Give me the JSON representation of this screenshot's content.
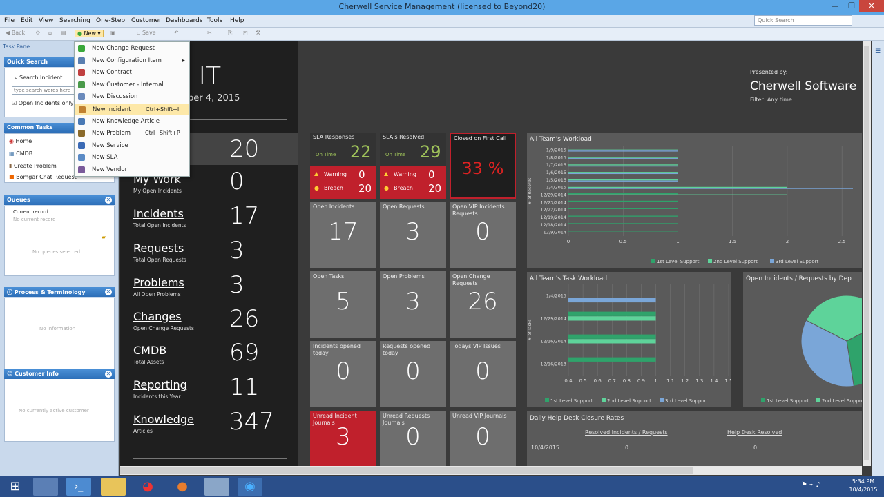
{
  "window": {
    "title": "Cherwell Service Management (licensed to Beyond20)"
  },
  "menubar": [
    "File",
    "Edit",
    "View",
    "Searching",
    "One-Step",
    "Customer",
    "Dashboards",
    "Tools",
    "Help"
  ],
  "quick_search_placeholder": "Quick Search",
  "toolbar": {
    "back": "Back",
    "new": "New",
    "save": "Save"
  },
  "task_pane": {
    "title": "Task Pane",
    "quick_search": {
      "title": "Quick Search",
      "search_label": "Search Incident",
      "input_value": "type search words here",
      "checkbox_label": "Open Incidents only"
    },
    "common_tasks": {
      "title": "Common Tasks",
      "items": [
        "Home",
        "CMDB",
        "Create Problem",
        "Bomgar Chat Request"
      ]
    },
    "queues": {
      "title": "Queues",
      "current_record_label": "Current record",
      "current_record_value": "No current record",
      "empty": "No queues selected"
    },
    "process": {
      "title": "Process & Terminology",
      "empty": "No information"
    },
    "customer": {
      "title": "Customer Info",
      "empty": "No currently active customer"
    }
  },
  "new_menu": [
    {
      "label": "New Change Request",
      "shortcut": "",
      "icon_color": "#3aa83a"
    },
    {
      "label": "New Configuration Item",
      "shortcut": "",
      "icon_color": "#5a7fb0",
      "submenu": true
    },
    {
      "label": "New Contract",
      "shortcut": "",
      "icon_color": "#c04040"
    },
    {
      "label": "New Customer - Internal",
      "shortcut": "",
      "icon_color": "#4a9a4a"
    },
    {
      "label": "New Discussion",
      "shortcut": "",
      "icon_color": "#6a8abb"
    },
    {
      "label": "New Incident",
      "shortcut": "Ctrl+Shift+I",
      "icon_color": "#c08030",
      "highlight": true
    },
    {
      "label": "New Knowledge Article",
      "shortcut": "",
      "icon_color": "#4a7ab5"
    },
    {
      "label": "New Problem",
      "shortcut": "Ctrl+Shift+P",
      "icon_color": "#8a6a2a"
    },
    {
      "label": "New Service",
      "shortcut": "",
      "icon_color": "#3a6ab5"
    },
    {
      "label": "New SLA",
      "shortcut": "",
      "icon_color": "#5a8ac5"
    },
    {
      "label": "New Vendor",
      "shortcut": "",
      "icon_color": "#7a5a9a"
    }
  ],
  "dashboard": {
    "title_partial": "al IT",
    "date_partial": "ber 4, 2015",
    "presented_by": "Presented by:",
    "brand": "Cherwell Software",
    "filter": "Filter: Any time",
    "first_num": "20",
    "first_sub": "nts",
    "metrics": [
      {
        "label": "My Work",
        "sub": "My Open Incidents",
        "value": "0"
      },
      {
        "label": "Incidents",
        "sub": "Total Open Incidents",
        "value": "17"
      },
      {
        "label": "Requests",
        "sub": "Total Open Requests",
        "value": "3"
      },
      {
        "label": "Problems",
        "sub": "All Open Problems",
        "value": "3"
      },
      {
        "label": "Changes",
        "sub": "Open Change Requests",
        "value": "26"
      },
      {
        "label": "CMDB",
        "sub": "Total Assets",
        "value": "69"
      },
      {
        "label": "Reporting",
        "sub": "Incidents this Year",
        "value": "11"
      },
      {
        "label": "Knowledge",
        "sub": "Articles",
        "value": "347"
      }
    ],
    "sla": [
      {
        "title": "SLA Responses",
        "ontime_label": "On Time",
        "ontime": "22",
        "warning_label": "Warning",
        "warning": "0",
        "breach_label": "Breach",
        "breach": "20"
      },
      {
        "title": "SLA's Resolved",
        "ontime_label": "On Time",
        "ontime": "29",
        "warning_label": "Warning",
        "warning": "0",
        "breach_label": "Breach",
        "breach": "20"
      }
    ],
    "first_call": {
      "title": "Closed on First Call",
      "value": "33 %"
    },
    "tiles": [
      {
        "title": "Open Incidents",
        "value": "17"
      },
      {
        "title": "Open Requests",
        "value": "3"
      },
      {
        "title": "Open VIP Incidents Requests",
        "value": "0"
      },
      {
        "title": "Open Tasks",
        "value": "5"
      },
      {
        "title": "Open Problems",
        "value": "3"
      },
      {
        "title": "Open Change Requests",
        "value": "26"
      },
      {
        "title": "Incidents opened today",
        "value": "0"
      },
      {
        "title": "Requests opened today",
        "value": "0"
      },
      {
        "title": "Todays VIP Issues",
        "value": "0"
      },
      {
        "title": "Unread Incident Journals",
        "value": "3",
        "red": true
      },
      {
        "title": "Unread Requests Journals",
        "value": "0"
      },
      {
        "title": "Unread VIP Journals",
        "value": "0"
      }
    ],
    "workload_title": "All Team's Workload",
    "task_workload_title": "All Team's Task Workload",
    "pie_title": "Open Incidents / Requests by Dep",
    "closure": {
      "title": "Daily Help Desk Closure Rates",
      "col1": "Resolved Incidents / Requests",
      "col2": "Help Desk Resolved",
      "row_date": "10/4/2015",
      "row_v1": "0",
      "row_v2": "0"
    }
  },
  "legend": [
    "1st Level Support",
    "2nd Level Support",
    "3rd Level Support"
  ],
  "legend_colors": [
    "#2fa36b",
    "#5ed39a",
    "#7aa6d8"
  ],
  "chart_data": [
    {
      "type": "bar",
      "title": "All Team's Workload",
      "ylabel": "# of Records",
      "categories": [
        "1/9/2015",
        "1/8/2015",
        "1/7/2015",
        "1/6/2015",
        "1/5/2015",
        "1/4/2015",
        "12/29/2014",
        "12/23/2014",
        "12/22/2014",
        "12/19/2014",
        "12/18/2014",
        "12/9/2014"
      ],
      "x_ticks": [
        "0",
        "0.5",
        "1",
        "1.5",
        "2",
        "2.5"
      ],
      "xlim": [
        0,
        2.6
      ],
      "series": [
        {
          "name": "1st Level Support",
          "values": [
            0,
            0,
            0,
            0,
            0,
            0,
            1,
            1,
            1,
            1,
            1,
            1
          ]
        },
        {
          "name": "2nd Level Support",
          "values": [
            1,
            1,
            1,
            1,
            1,
            2,
            2,
            0,
            0,
            0,
            0,
            0
          ]
        },
        {
          "name": "3rd Level Support",
          "values": [
            1,
            1,
            1,
            1,
            1,
            2.6,
            0,
            0,
            0,
            0,
            0,
            0
          ]
        }
      ]
    },
    {
      "type": "bar",
      "title": "All Team's Task Workload",
      "ylabel": "# of Tasks",
      "categories": [
        "1/4/2015",
        "12/29/2014",
        "12/16/2014",
        "12/16/2013"
      ],
      "x_ticks": [
        "0.4",
        "0.5",
        "0.6",
        "0.7",
        "0.8",
        "0.9",
        "1",
        "1.1",
        "1.2",
        "1.3",
        "1.4",
        "1.5"
      ],
      "xlim": [
        0.4,
        1.5
      ],
      "series": [
        {
          "name": "1st Level Support",
          "values": [
            0.4,
            1,
            1,
            1
          ]
        },
        {
          "name": "2nd Level Support",
          "values": [
            0.4,
            1,
            1,
            0.4
          ]
        },
        {
          "name": "3rd Level Support",
          "values": [
            1,
            0.4,
            0.4,
            0.4
          ]
        }
      ]
    },
    {
      "type": "pie",
      "title": "Open Incidents / Requests by Dep",
      "slices": [
        {
          "name": "1st Level Support",
          "value": 30
        },
        {
          "name": "2nd Level Support",
          "value": 35
        },
        {
          "name": "3rd Level Support",
          "value": 35
        }
      ]
    }
  ],
  "taskbar": {
    "time": "5:34 PM",
    "date": "10/4/2015"
  }
}
